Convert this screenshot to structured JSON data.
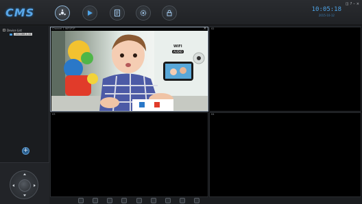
{
  "app": {
    "logo": "CMS",
    "colors": {
      "accent": "#4ea3e6",
      "background": "#1d1f22",
      "video_bg": "#000000"
    }
  },
  "nav": [
    {
      "icon": "camera-monitor-icon",
      "active": true
    },
    {
      "icon": "play-icon",
      "active": false
    },
    {
      "icon": "log-document-icon",
      "active": false
    },
    {
      "icon": "settings-gear-icon",
      "active": false
    },
    {
      "icon": "lock-icon",
      "active": false
    }
  ],
  "clock": {
    "time": "10:05:18",
    "date": "2015-10-12"
  },
  "window_controls": [
    "◫",
    "?",
    "–",
    "×"
  ],
  "tree": {
    "root_label": "Device List",
    "child_label": "192.168.1.10"
  },
  "left": {
    "add_label": "+"
  },
  "video": {
    "cells": [
      {
        "id": "1",
        "header": "Channel 1  WiFi/P2P",
        "close": "×",
        "has_feed": true,
        "feed_labels": [
          "WIFI",
          "AUDIO"
        ]
      },
      {
        "id": "2",
        "header": "02",
        "close": "",
        "has_feed": false
      },
      {
        "id": "3",
        "header": "03",
        "close": "",
        "has_feed": false
      },
      {
        "id": "4",
        "header": "04",
        "close": "",
        "has_feed": false
      }
    ]
  },
  "toolbar": [
    {
      "icon": "snapshot-icon"
    },
    {
      "icon": "record-icon"
    },
    {
      "icon": "refresh-icon"
    },
    {
      "icon": "audio-icon"
    },
    {
      "icon": "split-1-icon"
    },
    {
      "icon": "split-4-icon"
    },
    {
      "icon": "split-9-icon"
    },
    {
      "icon": "fullscreen-icon"
    },
    {
      "icon": "stop-all-icon"
    }
  ]
}
